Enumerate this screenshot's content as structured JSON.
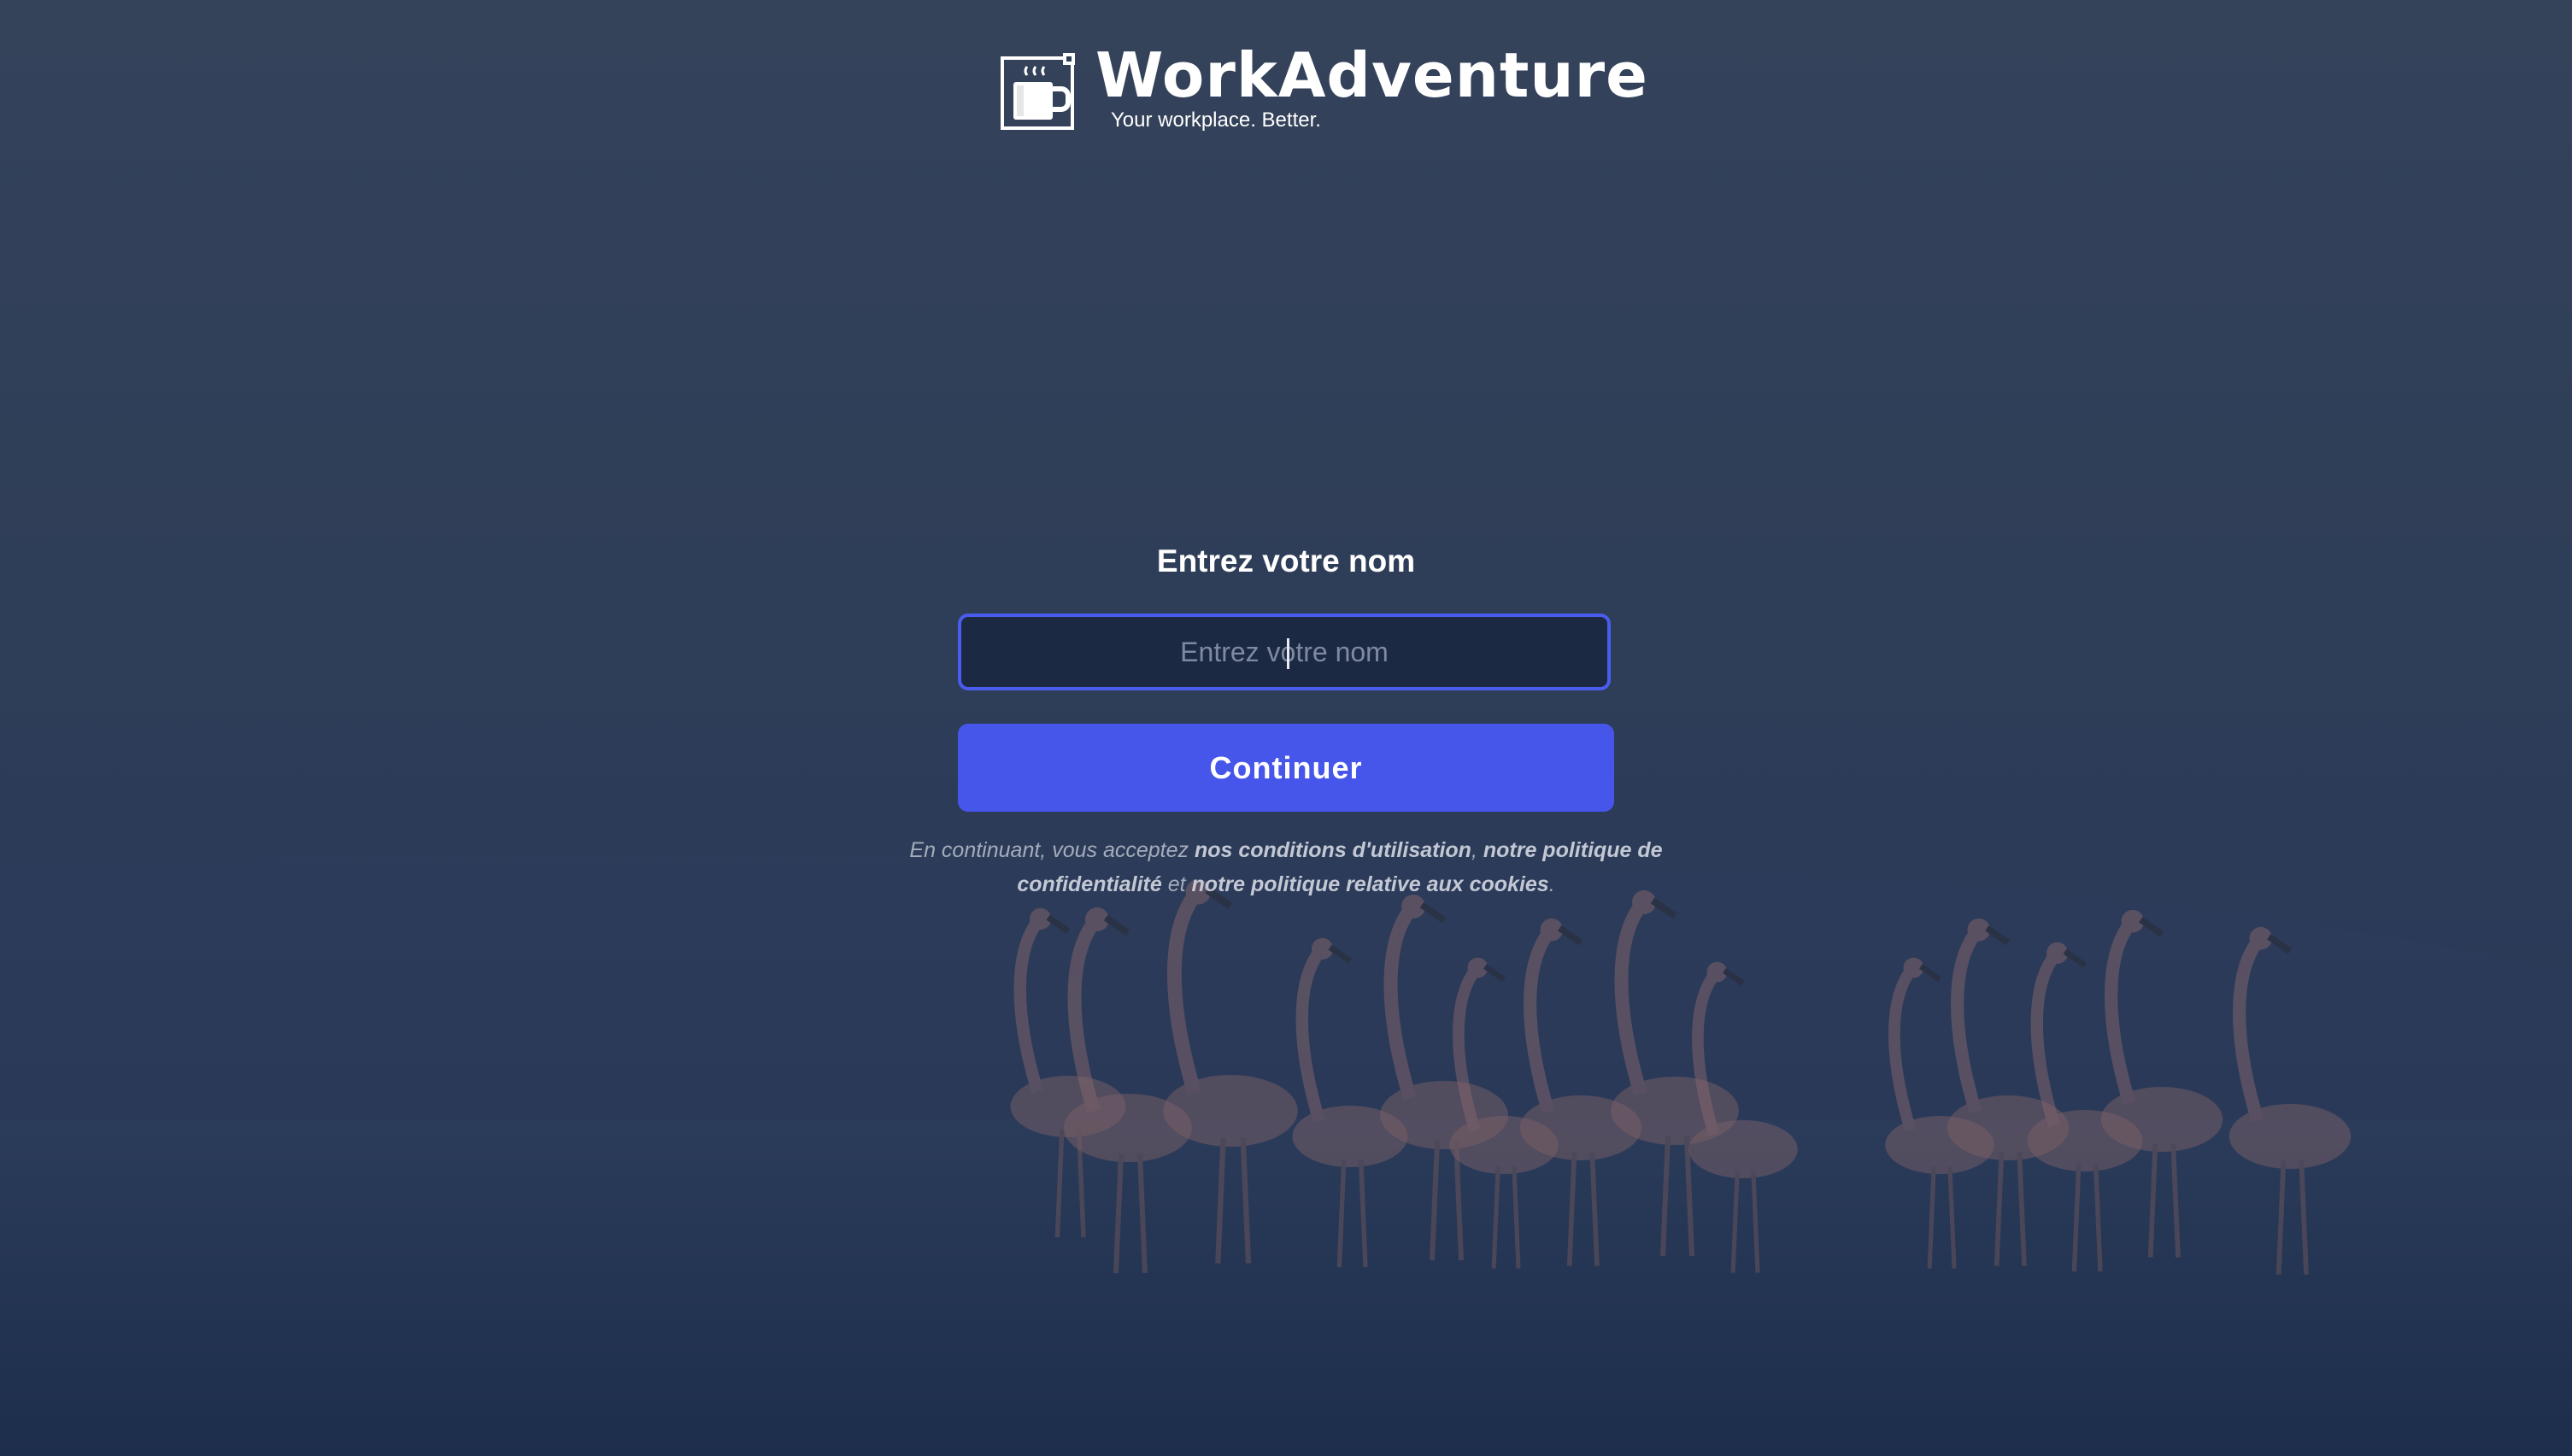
{
  "brand": {
    "name": "WorkAdventure",
    "tagline": "Your workplace. Better.",
    "logo_icon": "coffee-mug-icon"
  },
  "login": {
    "title": "Entrez votre nom",
    "name_input_placeholder": "Entrez votre nom",
    "name_input_value": "",
    "continue_label": "Continuer"
  },
  "terms": {
    "prefix": "En continuant, vous acceptez ",
    "terms_link": "nos conditions d'utilisation",
    "separator": ", ",
    "privacy_link": "notre politique de confidentialité",
    "conjunction": " et ",
    "cookies_link": "notre politique relative aux cookies",
    "suffix": "."
  },
  "colors": {
    "background": "#2f3e58",
    "input_background": "#1c2942",
    "input_border": "#4a5ced",
    "button": "#4656ea",
    "text": "#ffffff",
    "terms_text": "#a5acbb"
  }
}
